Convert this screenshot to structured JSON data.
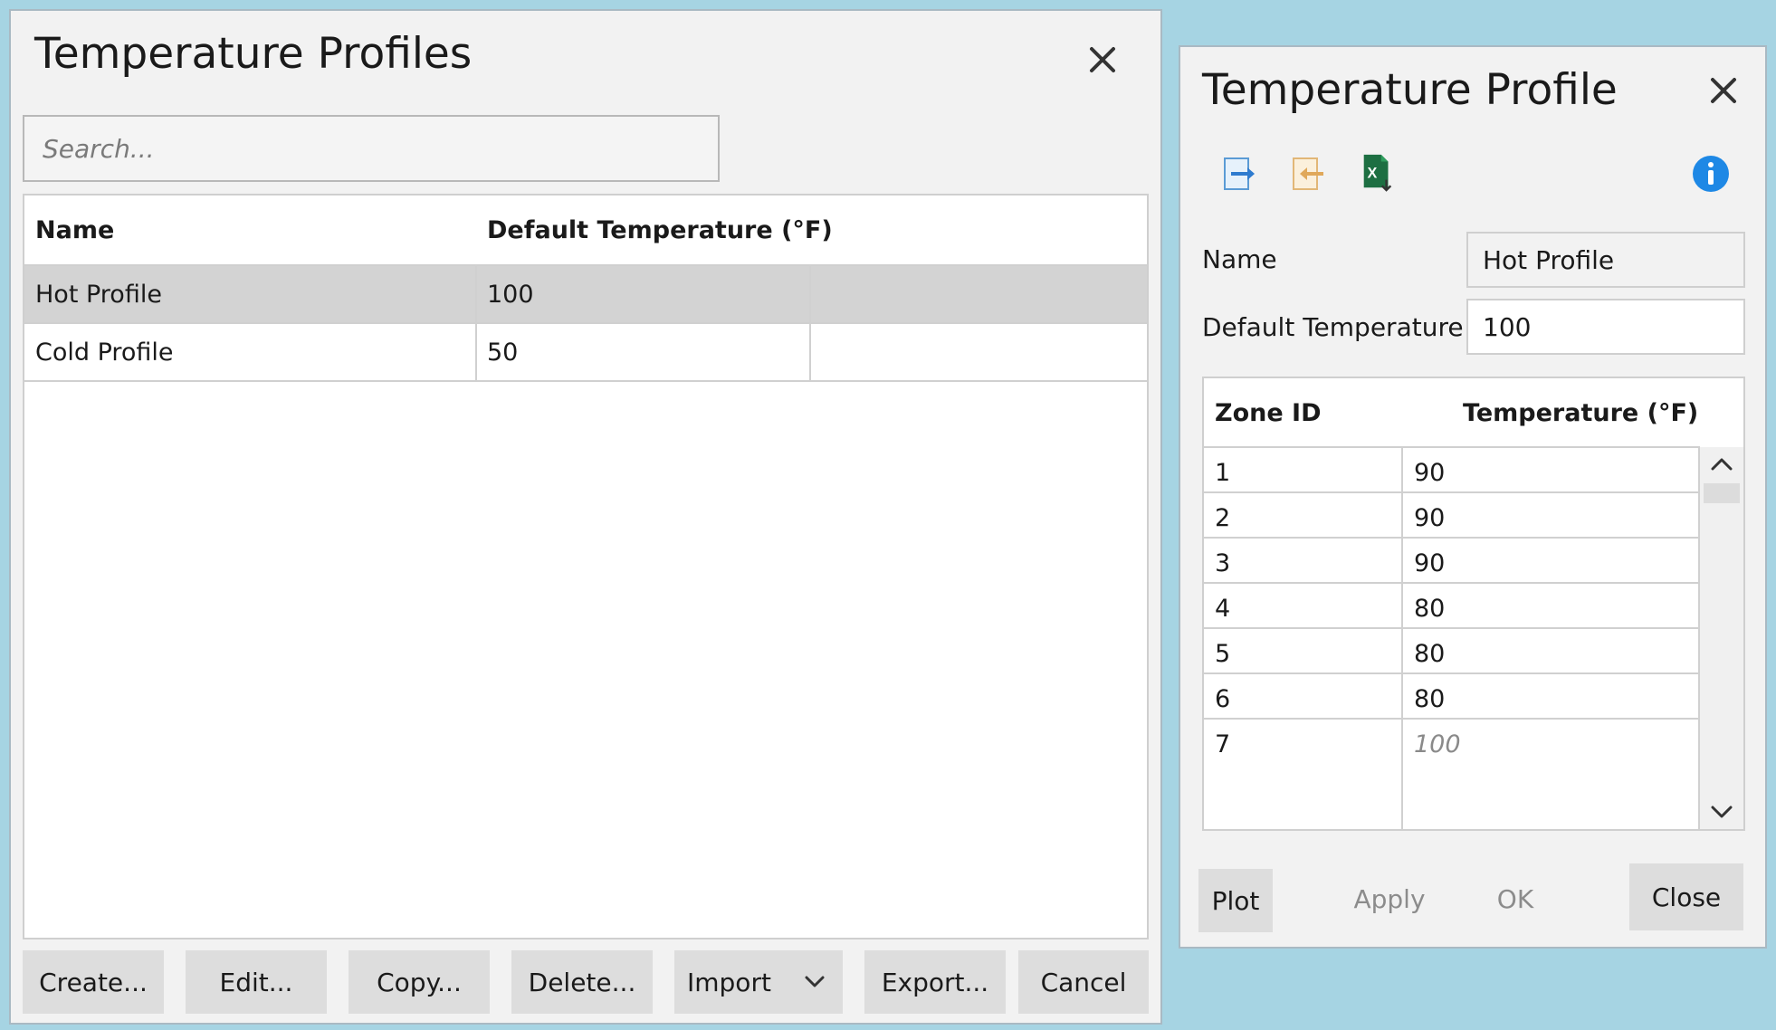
{
  "profiles_dialog": {
    "title": "Temperature Profiles",
    "search_placeholder": "Search...",
    "columns": [
      "Name",
      "Default Temperature (°F)"
    ],
    "rows": [
      {
        "name": "Hot Profile",
        "default_temp": "100",
        "selected": true
      },
      {
        "name": "Cold Profile",
        "default_temp": "50",
        "selected": false
      }
    ],
    "buttons": {
      "create": "Create...",
      "edit": "Edit...",
      "copy": "Copy...",
      "delete": "Delete...",
      "import": "Import",
      "export": "Export...",
      "cancel": "Cancel"
    }
  },
  "profile_editor": {
    "title": "Temperature Profile",
    "name_label": "Name",
    "name_value": "Hot Profile",
    "default_temp_label": "Default Temperature",
    "default_temp_value": "100",
    "columns": [
      "Zone ID",
      "Temperature (°F)"
    ],
    "zones": [
      {
        "id": "1",
        "temp": "90"
      },
      {
        "id": "2",
        "temp": "90"
      },
      {
        "id": "3",
        "temp": "90"
      },
      {
        "id": "4",
        "temp": "80"
      },
      {
        "id": "5",
        "temp": "80"
      },
      {
        "id": "6",
        "temp": "80"
      },
      {
        "id": "7",
        "temp": "100"
      }
    ],
    "buttons": {
      "plot": "Plot",
      "apply": "Apply",
      "ok": "OK",
      "close": "Close"
    }
  },
  "icons": {
    "close": "close-icon",
    "export": "export-arrow-icon",
    "import": "import-arrow-icon",
    "excel": "excel-icon",
    "info": "info-icon",
    "dropdown": "chevron-down-icon"
  },
  "colors": {
    "desktop": "#a6d4e3",
    "dialog_bg": "#f2f2f2",
    "selected_row": "#d3d3d3",
    "button_bg": "#dddddd",
    "info_blue": "#1e88e5",
    "excel_green": "#1d6f42"
  }
}
